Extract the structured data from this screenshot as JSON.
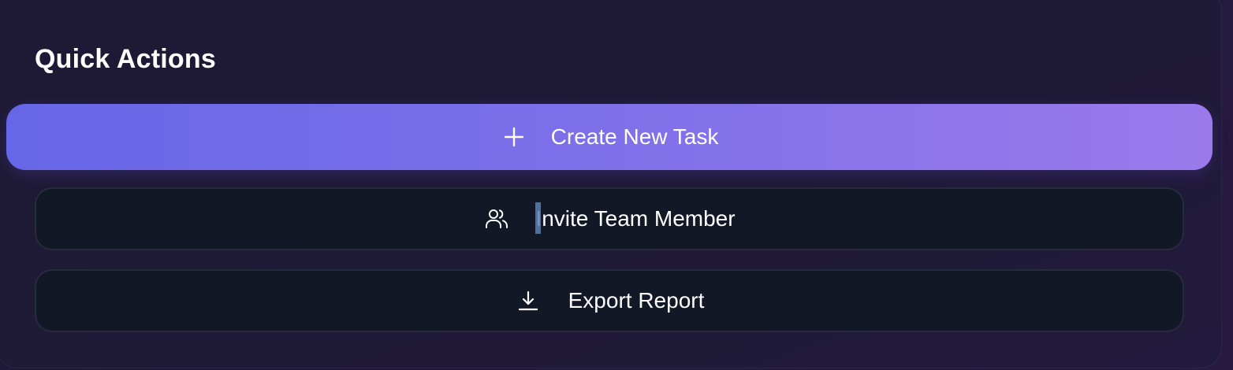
{
  "panel": {
    "title": "Quick Actions"
  },
  "actions": {
    "create": {
      "label": "Create New Task",
      "icon": "plus-icon"
    },
    "invite": {
      "label": "Invite Team Member",
      "icon": "users-icon"
    },
    "export": {
      "label": "Export Report",
      "icon": "download-icon"
    }
  },
  "colors": {
    "primary_start": "#6667e8",
    "primary_end": "#9a7aeb",
    "secondary_bg": "#131826",
    "secondary_border": "#262c3e",
    "text": "#ffffff"
  }
}
